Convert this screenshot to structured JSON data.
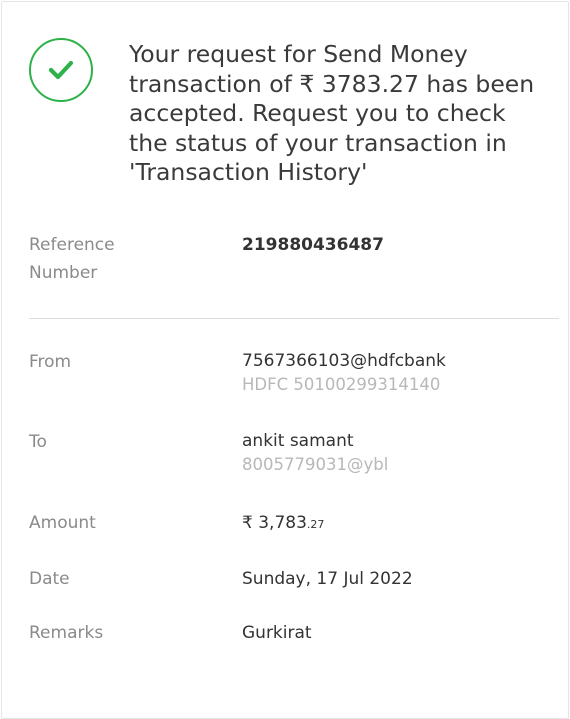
{
  "banner": {
    "icon": "check-circle-icon",
    "accent_color": "#2db24a",
    "message": "Your request for Send Money transaction of ₹ 3783.27 has been accepted. Request you to check the status of your transaction in 'Transaction History'"
  },
  "reference": {
    "label": "Reference Number",
    "value": "219880436487"
  },
  "from": {
    "label": "From",
    "vpa": "7567366103@hdfcbank",
    "account": "HDFC 50100299314140"
  },
  "to": {
    "label": "To",
    "name": "ankit samant",
    "vpa": "8005779031@ybl"
  },
  "amount": {
    "label": "Amount",
    "main": "₹ 3,783",
    "cents": ".27"
  },
  "date": {
    "label": "Date",
    "value": "Sunday, 17 Jul 2022"
  },
  "remarks": {
    "label": "Remarks",
    "value": "Gurkirat"
  }
}
